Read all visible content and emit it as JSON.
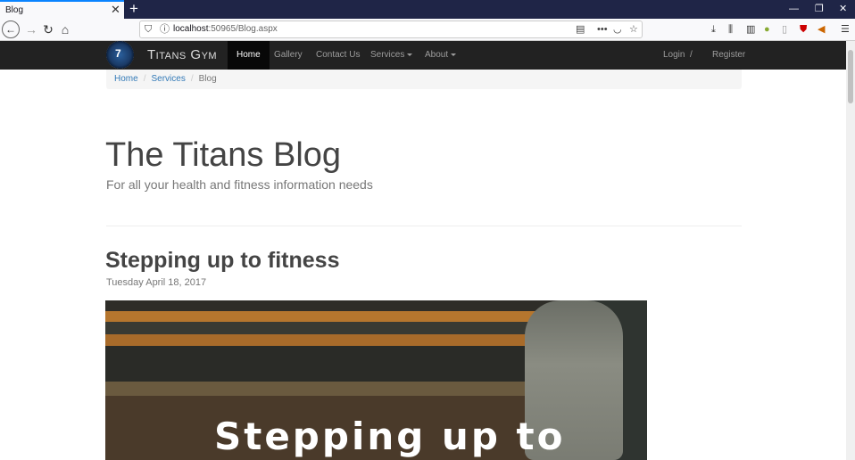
{
  "browser": {
    "tab_title": "Blog",
    "tab_close": "✕",
    "new_tab": "+",
    "window_controls": [
      "—",
      "❐",
      "✕"
    ],
    "url_host": "localhost",
    "url_rest": ":50965/Blog.aspx"
  },
  "navbar": {
    "brand": "Titans Gym",
    "items": [
      {
        "label": "Home",
        "active": true
      },
      {
        "label": "Gallery"
      },
      {
        "label": "Contact Us"
      },
      {
        "label": "Services",
        "dropdown": true
      },
      {
        "label": "About",
        "dropdown": true
      }
    ],
    "login": "Login",
    "separator": "/",
    "register": "Register"
  },
  "breadcrumb": {
    "items": [
      "Home",
      "Services",
      "Blog"
    ],
    "separator": "/"
  },
  "page": {
    "title": "The Titans Blog",
    "subtitle": "For all your health and fitness information needs"
  },
  "post": {
    "title": "Stepping up to fitness",
    "date": "Tuesday April 18, 2017",
    "image_caption": "Stepping up to"
  },
  "colors": {
    "tabstrip": "#1f2547",
    "navbar": "#222222",
    "link": "#337ab7"
  }
}
